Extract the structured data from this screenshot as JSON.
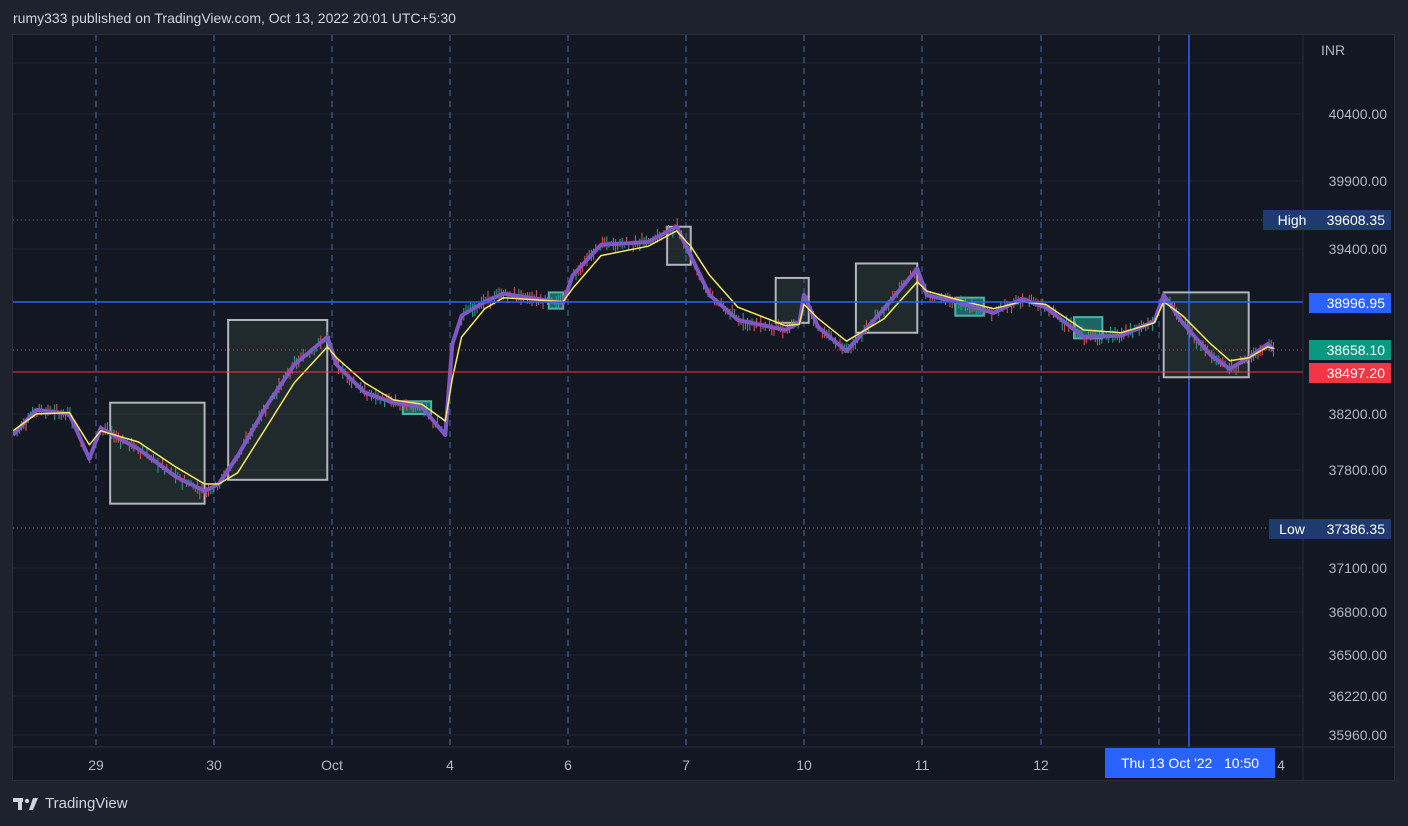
{
  "header": {
    "text": "rumy333 published on TradingView.com, Oct 13, 2022 20:01 UTC+5:30"
  },
  "footer": {
    "brand": "TradingView",
    "logo_icon": "tradingview-logo-icon"
  },
  "colors": {
    "background": "#131722",
    "grid": "#1f2330",
    "dashed_vline": "#3d6fb8",
    "blue_line": "#2962ff",
    "red_line": "#f23645",
    "green_label": "#089981",
    "red_label": "#f23645",
    "blue_label": "#2962ff",
    "hl_label": "#1e3a6e",
    "ema_fast": "#7e57c2",
    "ema_slow": "#f5e960",
    "candle_up": "#26a69a",
    "candle_down": "#ef5350",
    "zone_border": "#b2b5be",
    "zone_fill": "rgba(80,110,80,0.22)",
    "small_zone_fill": "rgba(38,166,154,0.55)"
  },
  "chart_data": {
    "type": "line",
    "currency": "INR",
    "y_ticks": [
      "40400.00",
      "39900.00",
      "39400.00",
      "38200.00",
      "37800.00",
      "37100.00",
      "36800.00",
      "36500.00",
      "36220.00",
      "35960.00"
    ],
    "x_ticks": [
      "29",
      "30",
      "Oct",
      "4",
      "6",
      "7",
      "10",
      "11",
      "12",
      "4"
    ],
    "price_labels": {
      "high": {
        "label": "High",
        "value": "39608.35"
      },
      "low": {
        "label": "Low",
        "value": "37386.35"
      },
      "horizontal_blue": "38996.95",
      "last": "38658.10",
      "horizontal_red": "38497.20"
    },
    "crosshair_time": "Thu 13 Oct '22   10:50",
    "series": [
      {
        "style": "ema-fast",
        "points": [
          [
            "Sep 28 09:15",
            38050
          ],
          [
            "Sep 28 11:00",
            38230
          ],
          [
            "Sep 28 13:30",
            38200
          ],
          [
            "Sep 28 15:00",
            37880
          ],
          [
            "Sep 29 09:30",
            38100
          ],
          [
            "Sep 29 11:30",
            37950
          ],
          [
            "Sep 29 13:30",
            37750
          ],
          [
            "Sep 29 15:00",
            37650
          ],
          [
            "Sep 30 09:30",
            37700
          ],
          [
            "Sep 30 10:30",
            37900
          ],
          [
            "Sep 30 12:00",
            38250
          ],
          [
            "Sep 30 13:30",
            38550
          ],
          [
            "Sep 30 15:15",
            38750
          ],
          [
            "Oct 03 09:30",
            38550
          ],
          [
            "Oct 03 11:00",
            38350
          ],
          [
            "Oct 03 12:30",
            38280
          ],
          [
            "Oct 03 14:00",
            38250
          ],
          [
            "Oct 03 15:15",
            38050
          ],
          [
            "Oct 04 09:30",
            38700
          ],
          [
            "Oct 04 10:30",
            38900
          ],
          [
            "Oct 04 13:00",
            39000
          ],
          [
            "Oct 04 15:00",
            39060
          ],
          [
            "Oct 05 15:00",
            38990
          ],
          [
            "Oct 06 09:30",
            39200
          ],
          [
            "Oct 06 11:00",
            39430
          ],
          [
            "Oct 06 13:30",
            39450
          ],
          [
            "Oct 06 15:00",
            39560
          ],
          [
            "Oct 07 09:30",
            39350
          ],
          [
            "Oct 07 10:30",
            39050
          ],
          [
            "Oct 07 12:00",
            38870
          ],
          [
            "Oct 07 14:30",
            38800
          ],
          [
            "Oct 07 15:15",
            38850
          ],
          [
            "Oct 10 09:15",
            39050
          ],
          [
            "Oct 10 10:00",
            38820
          ],
          [
            "Oct 10 11:30",
            38650
          ],
          [
            "Oct 10 13:30",
            38950
          ],
          [
            "Oct 10 15:15",
            39250
          ],
          [
            "Oct 11 09:30",
            39050
          ],
          [
            "Oct 11 11:00",
            39000
          ],
          [
            "Oct 11 13:00",
            38920
          ],
          [
            "Oct 11 14:30",
            39020
          ],
          [
            "Oct 12 09:30",
            38960
          ],
          [
            "Oct 12 11:30",
            38750
          ],
          [
            "Oct 12 13:30",
            38760
          ],
          [
            "Oct 12 15:15",
            38860
          ],
          [
            "Oct 13 09:30",
            39050
          ],
          [
            "Oct 13 10:30",
            38850
          ],
          [
            "Oct 13 12:00",
            38620
          ],
          [
            "Oct 13 13:00",
            38520
          ],
          [
            "Oct 13 14:00",
            38600
          ],
          [
            "Oct 13 15:00",
            38700
          ],
          [
            "Oct 13 15:20",
            38660
          ]
        ]
      },
      {
        "style": "ema-slow",
        "points": [
          [
            "Sep 28 09:15",
            38080
          ],
          [
            "Sep 28 11:00",
            38200
          ],
          [
            "Sep 28 13:30",
            38210
          ],
          [
            "Sep 28 15:00",
            37980
          ],
          [
            "Sep 29 09:30",
            38080
          ],
          [
            "Sep 29 11:30",
            38000
          ],
          [
            "Sep 29 13:30",
            37820
          ],
          [
            "Sep 29 15:00",
            37700
          ],
          [
            "Sep 30 09:30",
            37700
          ],
          [
            "Sep 30 10:30",
            37780
          ],
          [
            "Sep 30 12:00",
            38100
          ],
          [
            "Sep 30 13:30",
            38420
          ],
          [
            "Sep 30 15:15",
            38680
          ],
          [
            "Oct 03 09:30",
            38600
          ],
          [
            "Oct 03 11:00",
            38420
          ],
          [
            "Oct 03 12:30",
            38300
          ],
          [
            "Oct 03 14:00",
            38270
          ],
          [
            "Oct 03 15:15",
            38150
          ],
          [
            "Oct 04 09:30",
            38450
          ],
          [
            "Oct 04 10:30",
            38750
          ],
          [
            "Oct 04 13:00",
            38950
          ],
          [
            "Oct 04 15:00",
            39030
          ],
          [
            "Oct 05 15:00",
            39000
          ],
          [
            "Oct 06 09:30",
            39100
          ],
          [
            "Oct 06 11:00",
            39350
          ],
          [
            "Oct 06 13:30",
            39420
          ],
          [
            "Oct 06 15:00",
            39530
          ],
          [
            "Oct 07 09:30",
            39420
          ],
          [
            "Oct 07 10:30",
            39200
          ],
          [
            "Oct 07 12:00",
            38960
          ],
          [
            "Oct 07 14:30",
            38830
          ],
          [
            "Oct 07 15:15",
            38840
          ],
          [
            "Oct 10 09:15",
            38980
          ],
          [
            "Oct 10 10:00",
            38880
          ],
          [
            "Oct 10 11:30",
            38720
          ],
          [
            "Oct 10 13:30",
            38880
          ],
          [
            "Oct 10 15:15",
            39150
          ],
          [
            "Oct 11 09:30",
            39080
          ],
          [
            "Oct 11 11:00",
            39020
          ],
          [
            "Oct 11 13:00",
            38950
          ],
          [
            "Oct 11 14:30",
            39000
          ],
          [
            "Oct 12 09:30",
            38980
          ],
          [
            "Oct 12 11:30",
            38800
          ],
          [
            "Oct 12 13:30",
            38780
          ],
          [
            "Oct 12 15:15",
            38850
          ],
          [
            "Oct 13 09:30",
            39000
          ],
          [
            "Oct 13 10:30",
            38900
          ],
          [
            "Oct 13 12:00",
            38700
          ],
          [
            "Oct 13 13:00",
            38580
          ],
          [
            "Oct 13 14:00",
            38600
          ],
          [
            "Oct 13 15:00",
            38680
          ],
          [
            "Oct 13 15:20",
            38670
          ]
        ]
      }
    ],
    "zones": [
      {
        "kind": "large",
        "from": "Sep 29 10:00",
        "to": "Sep 29 15:00",
        "top": 38280,
        "bottom": 37560
      },
      {
        "kind": "large",
        "from": "Sep 30 10:00",
        "to": "Sep 30 15:15",
        "top": 38870,
        "bottom": 37730
      },
      {
        "kind": "small",
        "from": "Oct 03 13:00",
        "to": "Oct 03 14:30",
        "top": 38290,
        "bottom": 38200
      },
      {
        "kind": "small",
        "from": "Oct 05 13:30",
        "to": "Oct 05 15:00",
        "top": 39070,
        "bottom": 38950
      },
      {
        "kind": "large",
        "from": "Oct 06 14:30",
        "to": "Oct 07 09:30",
        "top": 39560,
        "bottom": 39280
      },
      {
        "kind": "large",
        "from": "Oct 07 14:00",
        "to": "Oct 10 09:30",
        "top": 39180,
        "bottom": 38850
      },
      {
        "kind": "large",
        "from": "Oct 10 12:00",
        "to": "Oct 10 15:15",
        "top": 39290,
        "bottom": 38780
      },
      {
        "kind": "small",
        "from": "Oct 11 11:00",
        "to": "Oct 11 12:30",
        "top": 39030,
        "bottom": 38900
      },
      {
        "kind": "small",
        "from": "Oct 12 11:00",
        "to": "Oct 12 12:30",
        "top": 38890,
        "bottom": 38740
      },
      {
        "kind": "large",
        "from": "Oct 13 09:30",
        "to": "Oct 13 14:00",
        "top": 39070,
        "bottom": 38460
      }
    ]
  }
}
